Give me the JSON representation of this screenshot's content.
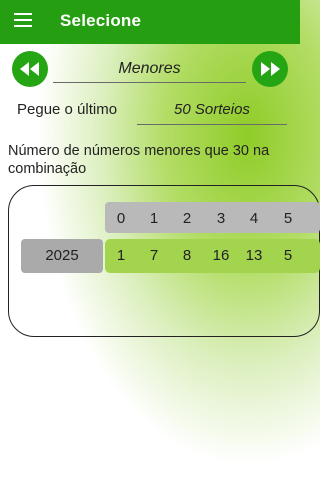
{
  "appbar": {
    "title": "Selecione",
    "menu_icon": "hamburger-menu-icon"
  },
  "selector": {
    "prev_icon": "double-chevron-left-icon",
    "next_icon": "double-chevron-right-icon",
    "value": "Menores"
  },
  "filter": {
    "label": "Pegue o último",
    "value": "50 Sorteios"
  },
  "description": "Número de números menores que 30 na combinação",
  "table": {
    "header": [
      "0",
      "1",
      "2",
      "3",
      "4",
      "5"
    ],
    "rows": [
      {
        "label": "2025",
        "values": [
          "1",
          "7",
          "8",
          "16",
          "13",
          "5"
        ]
      }
    ]
  },
  "colors": {
    "primary": "#269e11",
    "button": "#26a514",
    "row_green": "#a3d44e",
    "header_gray": "#b9b9b9"
  }
}
